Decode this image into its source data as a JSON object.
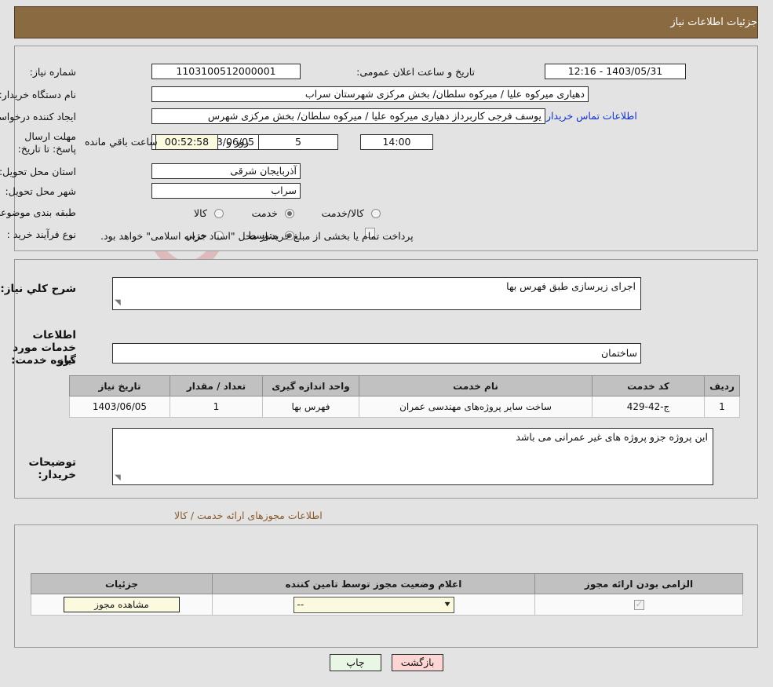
{
  "header": {
    "title": "جزئیات اطلاعات نیاز"
  },
  "watermark": {
    "text": "AriaTender.net"
  },
  "form": {
    "need_no_label": "شماره نیاز:",
    "need_no_value": "1103100512000001",
    "announce_label": "تاریخ و ساعت اعلان عمومی:",
    "announce_value": "1403/05/31 - 12:16",
    "buyer_org_label": "نام دستگاه خریدار:",
    "buyer_org_value": "دهیاری میرکوه علیا / میرکوه سلطان/ بخش مرکزی شهرستان سراب",
    "creator_label": "ایجاد کننده درخواست:",
    "creator_value": "یوسف  فرجی کاربرداز دهیاری میرکوه علیا / میرکوه سلطان/ بخش مرکزی شهرس",
    "contact_link": "اطلاعات تماس خریدار",
    "deadline_label": "مهلت ارسال پاسخ: تا تاریخ:",
    "deadline_date": "1403/06/05",
    "time_label": "ساعت",
    "deadline_time": "14:00",
    "days_value": "5",
    "days_word": "روز و",
    "countdown_value": "00:52:58",
    "countdown_suffix": "ساعت باقي مانده",
    "province_label": "استان محل تحویل:",
    "province_value": "آذربایجان شرقی",
    "city_label": "شهر محل تحویل:",
    "city_value": "سراب",
    "category_label": "طبقه بندی موضوعی:",
    "category_options": [
      {
        "label": "کالا",
        "selected": false
      },
      {
        "label": "خدمت",
        "selected": true
      },
      {
        "label": "کالا/خدمت",
        "selected": false
      }
    ],
    "process_label": "نوع فرآیند خرید :",
    "process_options": [
      {
        "label": "جزیي",
        "selected": false
      },
      {
        "label": "متوسط",
        "selected": true
      }
    ],
    "treasury_checkbox_checked": false,
    "treasury_text": "پرداخت تمام یا بخشی از مبلغ خرید،از محل \"اسناد خزانه اسلامی\" خواهد بود."
  },
  "need": {
    "summary_label": "شرح کلي نیاز:",
    "summary_value": "اجرای زیرسازی طبق فهرس بها",
    "services_heading": "اطلاعات خدمات مورد نیاز",
    "service_group_label": "گروه خدمت:",
    "service_group_value": "ساختمان",
    "table": {
      "columns": [
        "ردیف",
        "کد خدمت",
        "نام خدمت",
        "واحد اندازه گیری",
        "تعداد / مقدار",
        "تاریخ نیاز"
      ],
      "rows": [
        {
          "index": "1",
          "code": "ج-42-429",
          "name": "ساخت سایر پروژه‌های مهندسی عمران",
          "unit": "فهرس بها",
          "qty": "1",
          "date": "1403/06/05"
        }
      ]
    },
    "buyer_notes_label": "توضیحات خریدار:",
    "buyer_notes_value": "این پروژه جزو پروژه های غیر عمرانی می باشد"
  },
  "permits": {
    "heading": "اطلاعات مجوزهای ارائه خدمت / کالا",
    "columns": [
      "الزامی بودن ارائه مجوز",
      "اعلام وضعیت مجوز توسط تامین کننده",
      "جزئیات"
    ],
    "rows": [
      {
        "required_checked": true,
        "status_value": "--",
        "details_button": "مشاهده مجوز"
      }
    ]
  },
  "footer": {
    "print_label": "چاپ",
    "back_label": "بازگشت"
  }
}
